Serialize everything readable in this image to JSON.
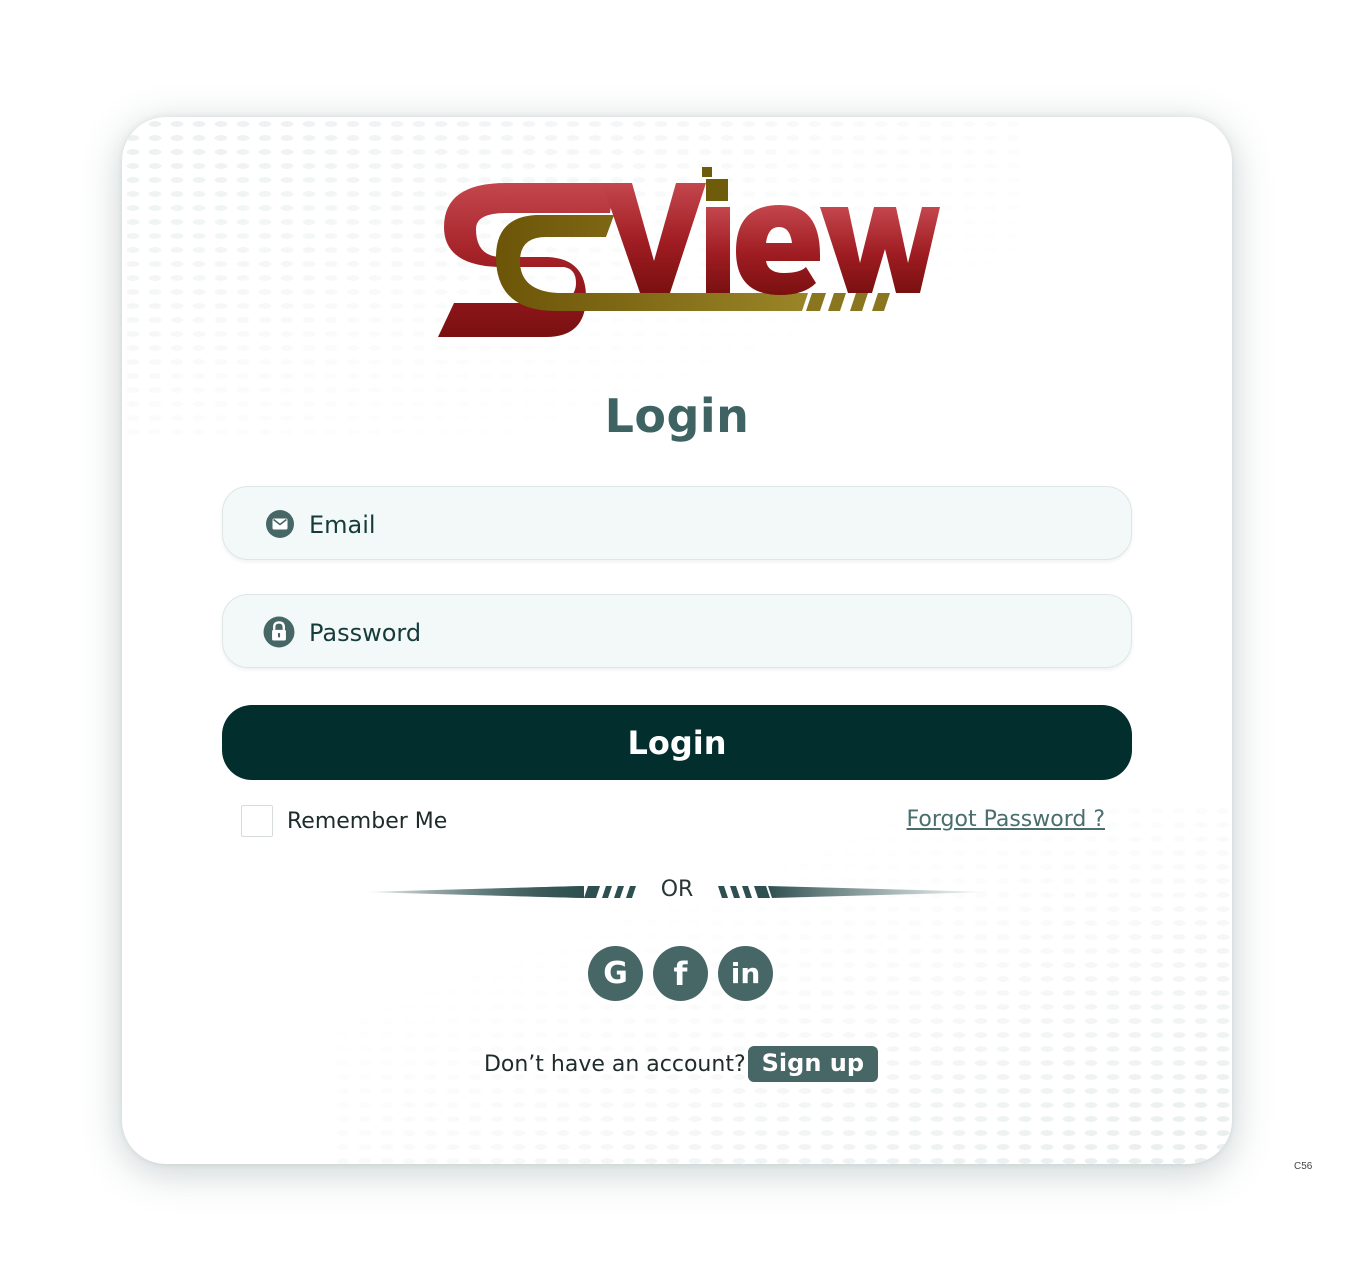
{
  "logo": {
    "text": "SView",
    "colors": {
      "red": "#a3212a",
      "olive": "#7f6a12"
    }
  },
  "login": {
    "title": "Login",
    "email_placeholder": "Email",
    "password_placeholder": "Password",
    "button_label": "Login",
    "remember_label": "Remember Me",
    "forgot_label": "Forgot Password ?",
    "or_label": "OR"
  },
  "social": {
    "items": [
      {
        "name": "google",
        "glyph": "G"
      },
      {
        "name": "facebook",
        "glyph": "f"
      },
      {
        "name": "linkedin",
        "glyph": "in"
      }
    ]
  },
  "signup": {
    "prompt": "Don’t have an account?",
    "button_label": "Sign up"
  },
  "page_code": "C56",
  "colors": {
    "primary_dark": "#022e2e",
    "accent": "#476767",
    "title": "#3f6262"
  }
}
